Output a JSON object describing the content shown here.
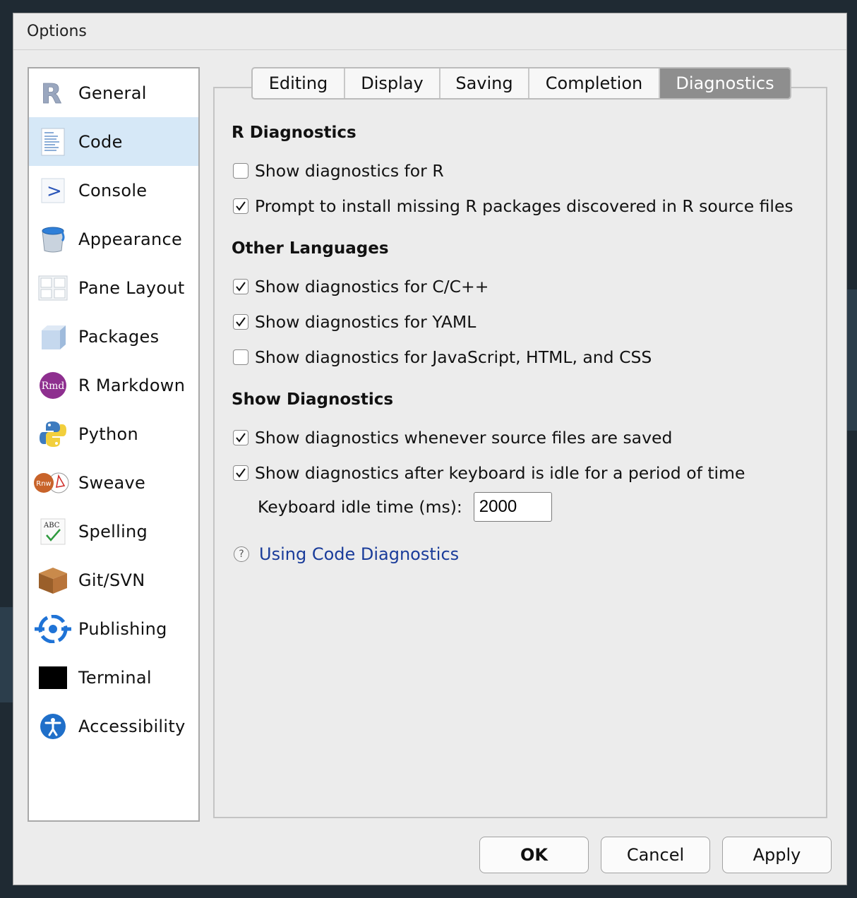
{
  "window": {
    "title": "Options"
  },
  "sidebar": {
    "items": [
      {
        "label": "General",
        "icon": "r-logo-icon"
      },
      {
        "label": "Code",
        "icon": "code-file-icon",
        "selected": true
      },
      {
        "label": "Console",
        "icon": "console-prompt-icon"
      },
      {
        "label": "Appearance",
        "icon": "paint-bucket-icon"
      },
      {
        "label": "Pane Layout",
        "icon": "pane-layout-icon"
      },
      {
        "label": "Packages",
        "icon": "package-cube-icon"
      },
      {
        "label": "R Markdown",
        "icon": "rmd-icon"
      },
      {
        "label": "Python",
        "icon": "python-icon"
      },
      {
        "label": "Sweave",
        "icon": "sweave-icon"
      },
      {
        "label": "Spelling",
        "icon": "spelling-icon"
      },
      {
        "label": "Git/SVN",
        "icon": "git-box-icon"
      },
      {
        "label": "Publishing",
        "icon": "publishing-icon"
      },
      {
        "label": "Terminal",
        "icon": "terminal-icon"
      },
      {
        "label": "Accessibility",
        "icon": "accessibility-icon"
      }
    ]
  },
  "tabs": [
    {
      "label": "Editing"
    },
    {
      "label": "Display"
    },
    {
      "label": "Saving"
    },
    {
      "label": "Completion"
    },
    {
      "label": "Diagnostics",
      "active": true
    }
  ],
  "sections": {
    "r_diagnostics": {
      "title": "R Diagnostics",
      "show_r": {
        "label": "Show diagnostics for R",
        "checked": false
      },
      "prompt_install": {
        "label": "Prompt to install missing R packages discovered in R source files",
        "checked": true
      }
    },
    "other_languages": {
      "title": "Other Languages",
      "cpp": {
        "label": "Show diagnostics for C/C++",
        "checked": true
      },
      "yaml": {
        "label": "Show diagnostics for YAML",
        "checked": true
      },
      "js": {
        "label": "Show diagnostics for JavaScript, HTML, and CSS",
        "checked": false
      }
    },
    "show_diagnostics": {
      "title": "Show Diagnostics",
      "on_save": {
        "label": "Show diagnostics whenever source files are saved",
        "checked": true
      },
      "on_idle": {
        "label": "Show diagnostics after keyboard is idle for a period of time",
        "checked": true
      },
      "idle_label": "Keyboard idle time (ms):",
      "idle_value": "2000"
    }
  },
  "help": {
    "icon_text": "?",
    "link": "Using Code Diagnostics"
  },
  "buttons": {
    "ok": "OK",
    "cancel": "Cancel",
    "apply": "Apply"
  },
  "colors": {
    "selected_bg": "#d6e8f7",
    "active_tab": "#8e8e8e",
    "link": "#1a3c9a"
  }
}
